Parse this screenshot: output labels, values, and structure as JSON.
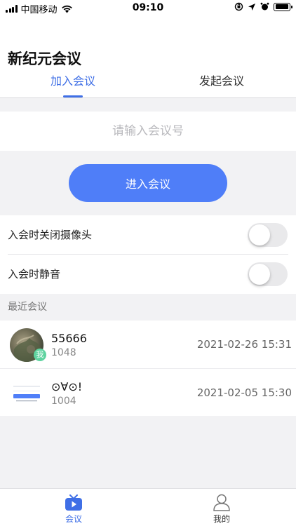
{
  "status_bar": {
    "carrier": "中国移动",
    "time": "09:10",
    "icons": [
      "signal-icon",
      "wifi-icon",
      "orientation-lock-icon",
      "location-icon",
      "alarm-icon",
      "battery-icon"
    ],
    "battery_level": 0.95
  },
  "header": {
    "title": "新纪元会议",
    "tabs": [
      {
        "label": "加入会议",
        "active": true
      },
      {
        "label": "发起会议",
        "active": false
      }
    ]
  },
  "join": {
    "input_placeholder": "请输入会议号",
    "input_value": "",
    "button_label": "进入会议"
  },
  "settings": [
    {
      "label": "入会时关闭摄像头",
      "enabled": false
    },
    {
      "label": "入会时静音",
      "enabled": false
    }
  ],
  "recent": {
    "section_title": "最近会议",
    "items": [
      {
        "name": "55666",
        "id": "1048",
        "time": "2021-02-26 15:31",
        "badge": "我"
      },
      {
        "name": "⊙∀⊙!",
        "id": "1004",
        "time": "2021-02-05 15:30"
      }
    ]
  },
  "tabbar": {
    "items": [
      {
        "label": "会议",
        "icon": "play-tv-icon",
        "active": true
      },
      {
        "label": "我的",
        "icon": "person-icon",
        "active": false
      }
    ]
  },
  "colors": {
    "accent": "#3f6fe6",
    "button": "#4f7ef8",
    "background": "#f2f2f4",
    "badge": "#5fd3a0"
  }
}
